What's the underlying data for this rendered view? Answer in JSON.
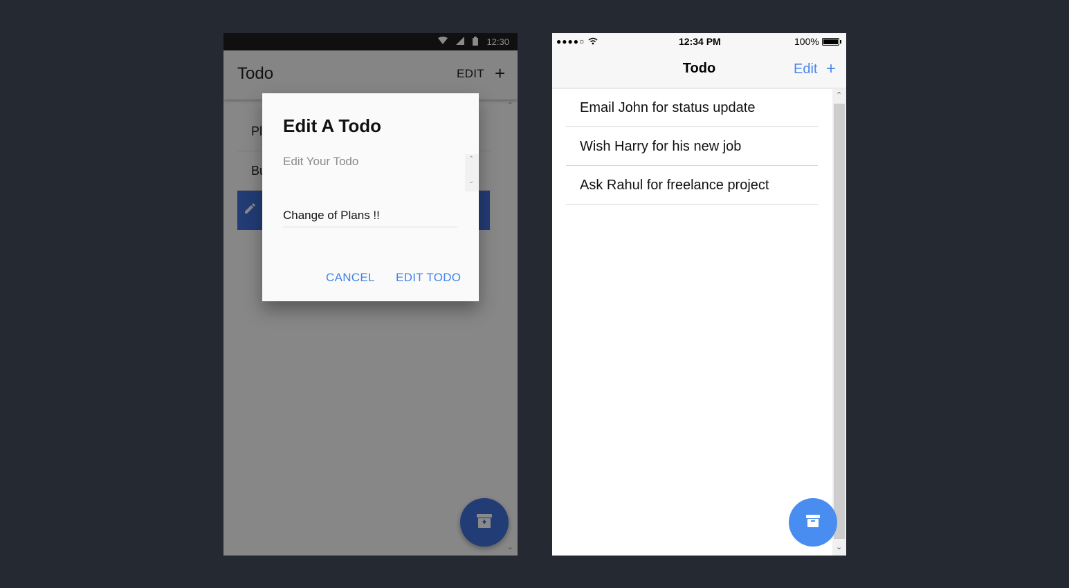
{
  "android": {
    "status_time": "12:30",
    "toolbar_title": "Todo",
    "edit_label": "EDIT",
    "add_label": "+",
    "list": [
      {
        "text": "Pl"
      },
      {
        "text": "Bu"
      },
      {
        "text": ""
      }
    ],
    "dialog": {
      "title": "Edit A Todo",
      "subtitle": "Edit Your Todo",
      "input_value": "Change of Plans !!",
      "cancel_label": "CANCEL",
      "confirm_label": "EDIT TODO"
    },
    "colors": {
      "accent": "#3f6fd9",
      "dialog_button": "#3f84e5"
    },
    "icons": {
      "fab": "archive-icon",
      "edit_row": "pencil-icon"
    }
  },
  "ios": {
    "status_signal": "●●●●○",
    "status_time": "12:34 PM",
    "battery_label": "100%",
    "nav_title": "Todo",
    "edit_label": "Edit",
    "add_label": "+",
    "list": [
      {
        "text": "Email John for status update"
      },
      {
        "text": "Wish Harry for his new job"
      },
      {
        "text": "Ask Rahul for freelance project"
      }
    ],
    "colors": {
      "accent": "#4a86e8",
      "fab": "#4a8df0"
    },
    "icons": {
      "fab": "archive-icon"
    }
  }
}
